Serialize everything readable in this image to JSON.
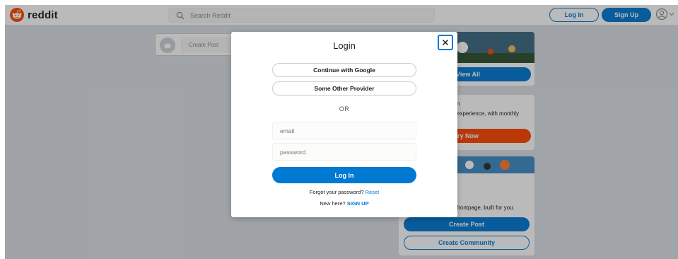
{
  "header": {
    "logo_text": "reddit",
    "search_placeholder": "Search Reddit",
    "login_label": "Log In",
    "signup_label": "Sign Up"
  },
  "create_post_bar": {
    "placeholder": "Create Post"
  },
  "sidebar": {
    "card1_button": "View All",
    "card2_title": "n",
    "card2_desc": "experience, with monthly",
    "card2_button": "ry Now",
    "card3_desc": "frontpage, built for you.",
    "card3_button_primary": "Create Post",
    "card3_button_secondary": "Create Community"
  },
  "modal": {
    "title": "Login",
    "google_label": "Continue with Google",
    "other_provider_label": "Some Other Provider",
    "or_label": "OR",
    "email_placeholder": "email",
    "password_placeholder": "password",
    "login_label": "Log In",
    "forgot_text": "Forgot your password?",
    "reset_label": "Reset",
    "new_here_text": "New here?",
    "signup_label": "SIGN UP"
  },
  "colors": {
    "brand_orange": "#ff4500",
    "accent_blue": "#0079d3",
    "page_bg": "#dae0e6"
  },
  "icons": [
    "reddit-logo-icon",
    "search-icon",
    "user-icon",
    "chevron-down-icon",
    "close-icon"
  ]
}
